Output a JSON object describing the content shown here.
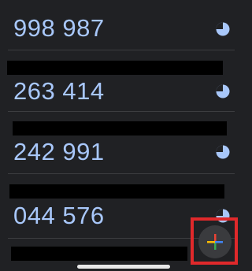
{
  "accounts": [
    {
      "code": "998 987",
      "timer_fraction": 0.75
    },
    {
      "code": "263 414",
      "timer_fraction": 0.75
    },
    {
      "code": "242 991",
      "timer_fraction": 0.75
    },
    {
      "code": "044 576",
      "timer_fraction": 0.75
    }
  ],
  "fab": {
    "icon": "plus-icon",
    "highlight_color": "#e0292b"
  },
  "colors": {
    "background": "#202124",
    "code_text": "#a8c7fa",
    "timer": "#a8c7fa",
    "redaction": "#000000"
  }
}
